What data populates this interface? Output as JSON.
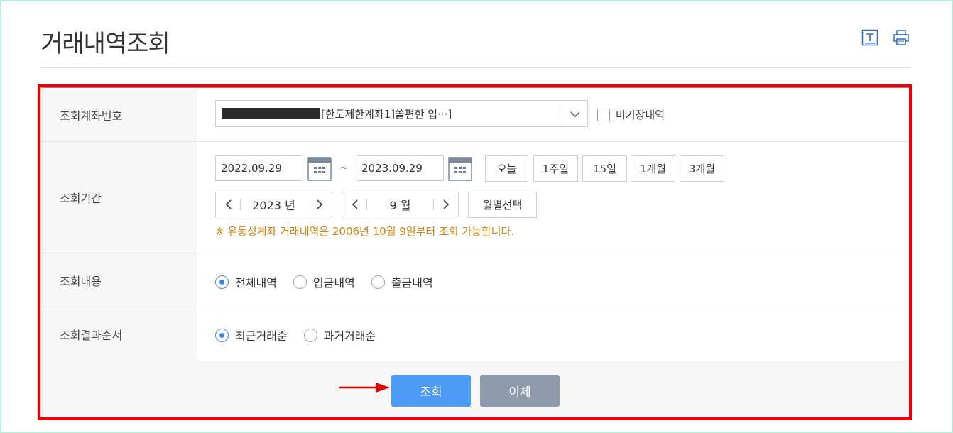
{
  "page": {
    "title": "거래내역조회"
  },
  "toolbar": {
    "icons": [
      "text-size-icon",
      "print-icon"
    ]
  },
  "rows": {
    "account": {
      "label": "조회계좌번호",
      "select_value": "[한도제한계좌1]쏠편한 입···]",
      "checkbox_label": "미기장내역"
    },
    "period": {
      "label": "조회기간",
      "start_date": "2022.09.29",
      "tilde": "~",
      "end_date": "2023.09.29",
      "quick_buttons": [
        "오늘",
        "1주일",
        "15일",
        "1개월",
        "3개월"
      ],
      "year_value": "2023 년",
      "month_value": "9 월",
      "month_select_label": "월별선택",
      "notice": "※ 유동성계좌 거래내역은 2006년 10월 9일부터 조회 가능합니다."
    },
    "content": {
      "label": "조회내용",
      "options": [
        "전체내역",
        "입금내역",
        "출금내역"
      ],
      "selected": "전체내역"
    },
    "order": {
      "label": "조회결과순서",
      "options": [
        "최근거래순",
        "과거거래순"
      ],
      "selected": "최근거래순"
    }
  },
  "actions": {
    "search_label": "조회",
    "transfer_label": "이체"
  },
  "colors": {
    "accent": "#4c9bf7",
    "notice": "#d4830c",
    "highlight": "#f20000",
    "secondary_btn": "#8e9aab"
  }
}
